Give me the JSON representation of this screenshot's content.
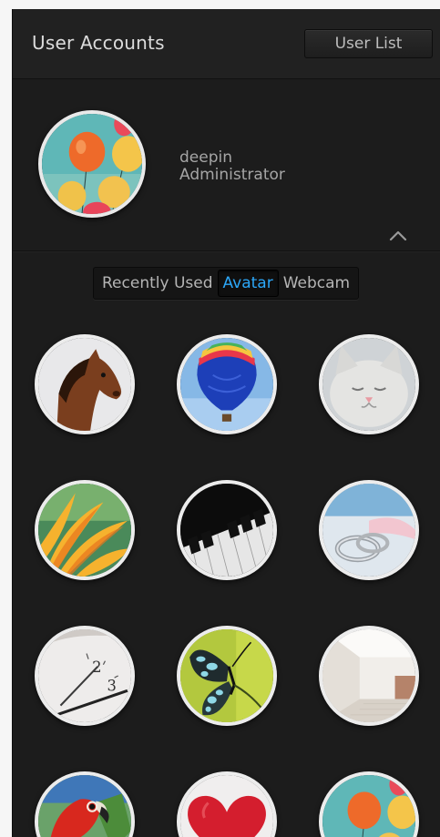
{
  "header": {
    "title": "User Accounts",
    "user_list_label": "User List"
  },
  "user": {
    "name": "deepin",
    "account_type": "Administrator",
    "avatar": "balloons-avatar-icon"
  },
  "tabs": [
    {
      "label": "Recently Used",
      "active": false
    },
    {
      "label": "Avatar",
      "active": true
    },
    {
      "label": "Webcam",
      "active": false
    }
  ],
  "colors": {
    "panel_bg": "#1c1c1c",
    "active_tab": "#2ca7f8",
    "text": "#a5a5a5"
  },
  "avatars": [
    {
      "icon": "horse-avatar-icon"
    },
    {
      "icon": "hot-air-balloon-avatar-icon"
    },
    {
      "icon": "cat-avatar-icon"
    },
    {
      "icon": "flower-avatar-icon"
    },
    {
      "icon": "piano-keys-avatar-icon"
    },
    {
      "icon": "rings-avatar-icon"
    },
    {
      "icon": "clock-avatar-icon"
    },
    {
      "icon": "butterfly-avatar-icon"
    },
    {
      "icon": "room-avatar-icon"
    },
    {
      "icon": "parrot-avatar-icon"
    },
    {
      "icon": "heart-avatar-icon"
    },
    {
      "icon": "balloons-avatar-icon"
    }
  ]
}
